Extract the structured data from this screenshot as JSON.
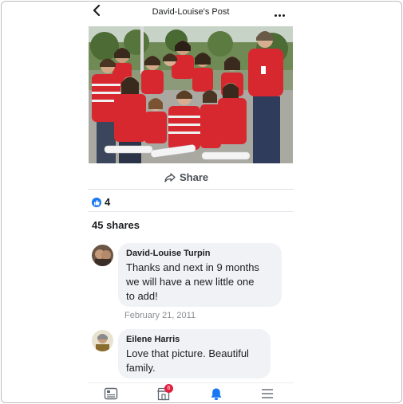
{
  "header": {
    "title": "David-Louise's Post",
    "back_icon": "chevron-left-icon",
    "more_icon": "more-dots-icon"
  },
  "post": {
    "share_label": "Share",
    "reaction_count": "4",
    "shares_text": "45 shares"
  },
  "comments": [
    {
      "author": "David-Louise Turpin",
      "lines": [
        "Thanks and next in 9 months",
        "we will have a new little one",
        "to add!"
      ],
      "date": "February 21, 2011"
    },
    {
      "author": "Eilene Harris",
      "lines": [
        "Love that picture. Beautiful",
        "family."
      ]
    }
  ],
  "bottom_nav": {
    "items": [
      "news-feed-icon",
      "marketplace-icon",
      "notifications-bell-icon",
      "menu-icon"
    ],
    "marketplace_badge": "6"
  },
  "colors": {
    "accent": "#1877f2",
    "badge": "#e41e3f",
    "bubble": "#f0f2f5",
    "shirt_red": "#d7282f"
  }
}
